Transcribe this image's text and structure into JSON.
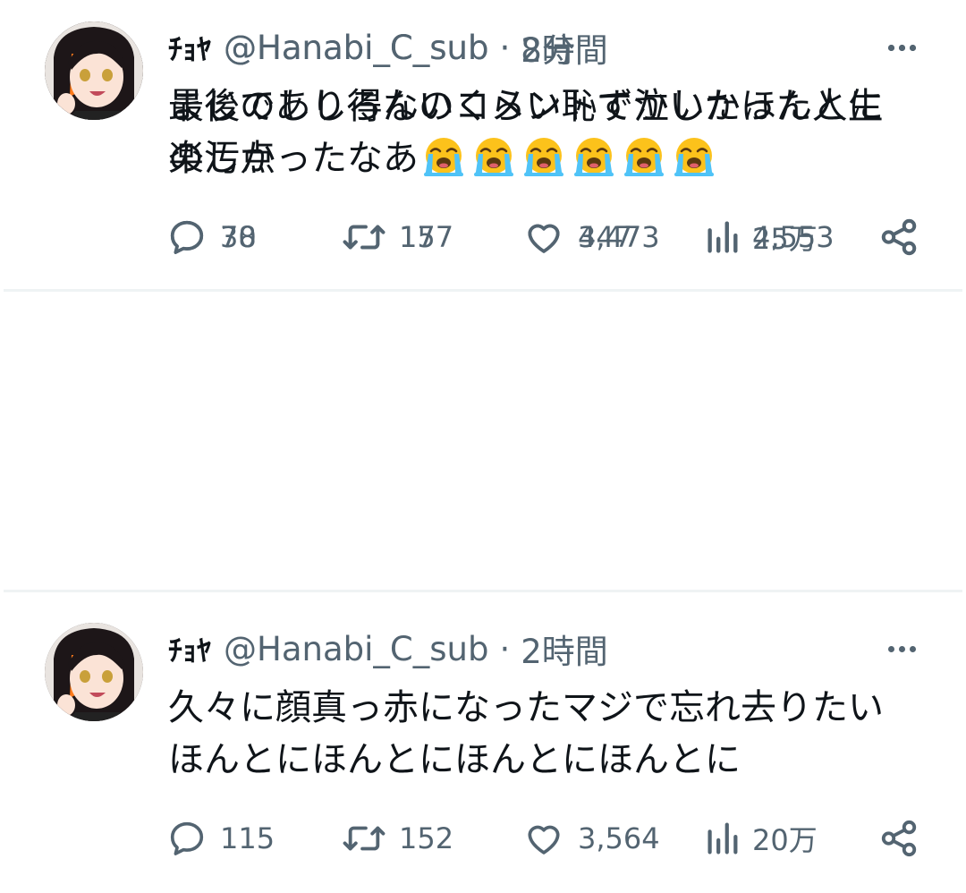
{
  "tweets": [
    {
      "display_name": "ﾁｮﾔ",
      "handle": "@Hanabi_C_sub",
      "separator": "·",
      "time": "8分",
      "lines": [
        "最後のししろんのコメントで泣いたほんとに",
        "楽しかったなあ"
      ],
      "emoji": "loudly-crying-face",
      "emoji_count": 6,
      "replies": "30",
      "retweets": "17",
      "likes": "447",
      "views": "4,553"
    },
    {
      "display_name": "ﾁｮﾔ",
      "handle": "@Hanabi_C_sub",
      "separator": "·",
      "time": "2時間",
      "lines": [
        "久々に顔真っ赤になったマジで忘れ去りたい",
        "ほんとにほんとにほんとにほんとに"
      ],
      "replies": "115",
      "retweets": "152",
      "likes": "3,564",
      "views": "20万"
    },
    {
      "display_name": "ﾁｮﾔ",
      "handle": "@Hanabi_C_sub",
      "separator": "·",
      "time": "2時間",
      "lines": [
        "まじであり得ないくらい恥ずかしかった人生",
        "の汚点"
      ],
      "replies": "78",
      "retweets": "157",
      "likes": "3,473",
      "views": "25万"
    }
  ],
  "icons": {
    "reply": "speech-bubble-icon",
    "retweet": "retweet-arrows-icon",
    "like": "heart-icon",
    "views": "bar-chart-icon",
    "share": "share-icon",
    "more": "three-dots-icon"
  },
  "colors": {
    "text_primary": "#0f1419",
    "text_secondary": "#536471",
    "divider": "#eff3f4",
    "emoji_face": "#fcc21b",
    "emoji_tears": "#4fc3f7"
  }
}
